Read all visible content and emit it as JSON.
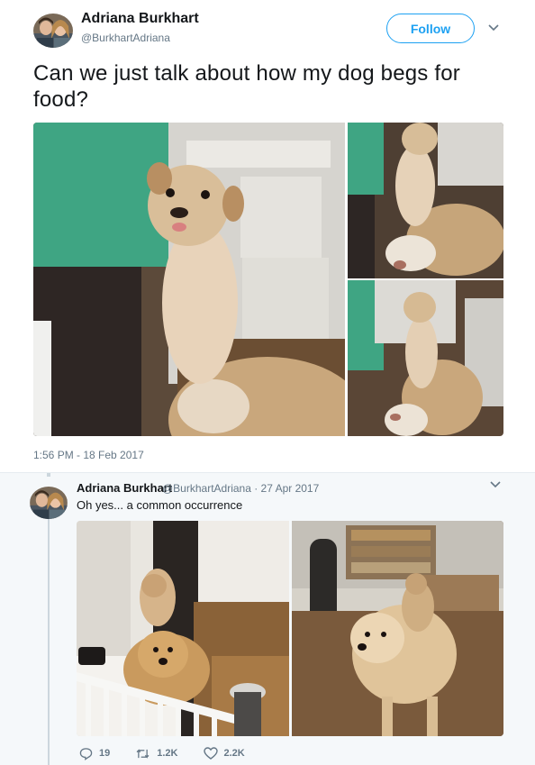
{
  "tweet": {
    "author_name": "Adriana Burkhart",
    "author_handle": "@BurkhartAdriana",
    "follow_label": "Follow",
    "text": "Can we just talk about how my dog begs for food?",
    "timestamp": "1:56 PM - 18 Feb 2017"
  },
  "reply": {
    "author_name": "Adriana Burkhart",
    "author_handle": "@BurkhartAdriana · 27 Apr 2017",
    "text": "Oh yes... a common occurrence",
    "actions": {
      "reply_count": "19",
      "retweet_count": "1.2K",
      "like_count": "2.2K"
    }
  },
  "icons": {
    "caret": "chevron-down-icon",
    "reply": "reply-icon",
    "retweet": "retweet-icon",
    "like": "heart-icon"
  },
  "colors": {
    "accent": "#1da1f2",
    "secondary_text": "#657786",
    "reply_background": "#f5f8fa"
  }
}
